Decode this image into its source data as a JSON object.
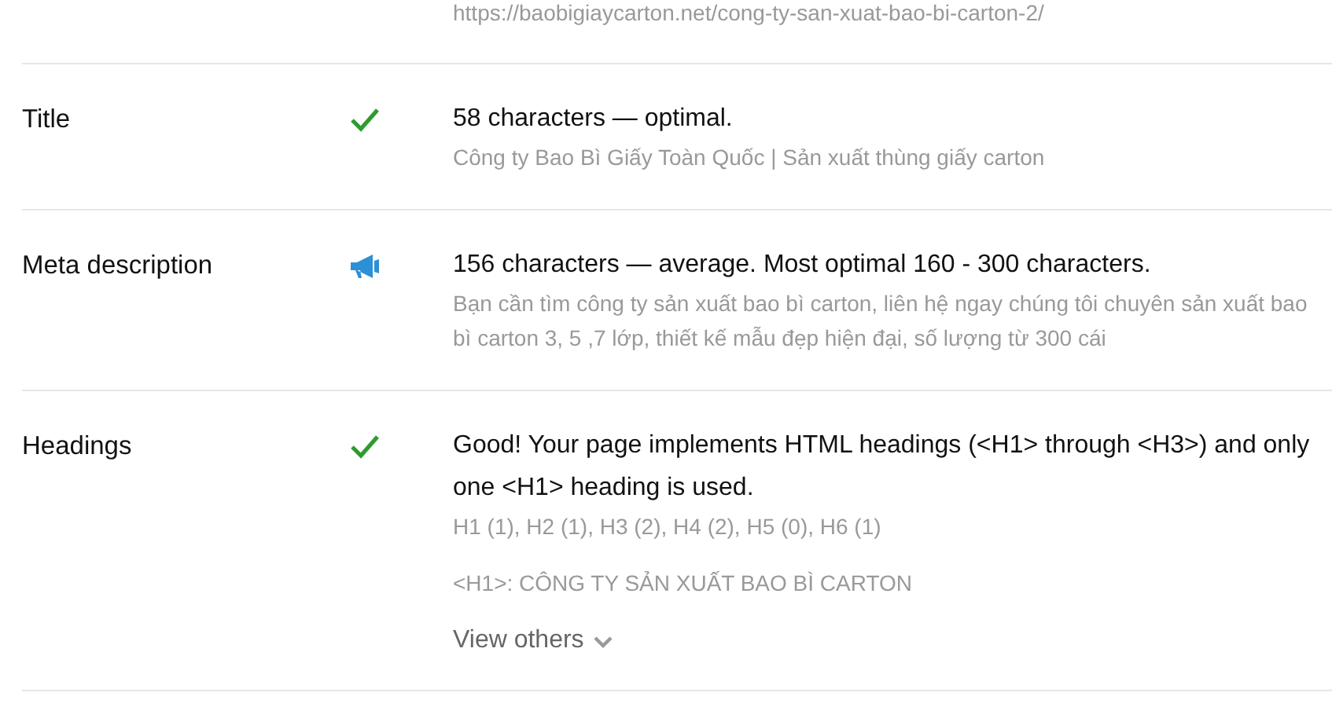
{
  "url_row": {
    "value": "https://baobigiaycarton.net/cong-ty-san-xuat-bao-bi-carton-2/"
  },
  "rows": [
    {
      "label": "Title",
      "kind": "ok",
      "summary": "58 characters — optimal.",
      "detail": "Công ty Bao Bì Giấy Toàn Quốc | Sản xuất thùng giấy carton"
    },
    {
      "label": "Meta description",
      "kind": "warn",
      "summary": "156 characters — average. Most optimal 160 - 300 characters.",
      "detail": "Bạn cần tìm công ty sản xuất bao bì carton, liên hệ ngay chúng tôi chuyên sản xuất bao bì carton 3, 5 ,7 lớp, thiết kế mẫu đẹp hiện đại, số lượng từ 300 cái"
    },
    {
      "label": "Headings",
      "kind": "ok",
      "summary": "Good! Your page implements HTML headings (<H1> through <H3>) and only one <H1> heading is used.",
      "detail": "H1 (1), H2 (1), H3 (2), H4 (2), H5 (0), H6 (1)",
      "h1": "<H1>: CÔNG TY SẢN XUẤT BAO BÌ CARTON",
      "more_link": "View others"
    }
  ]
}
